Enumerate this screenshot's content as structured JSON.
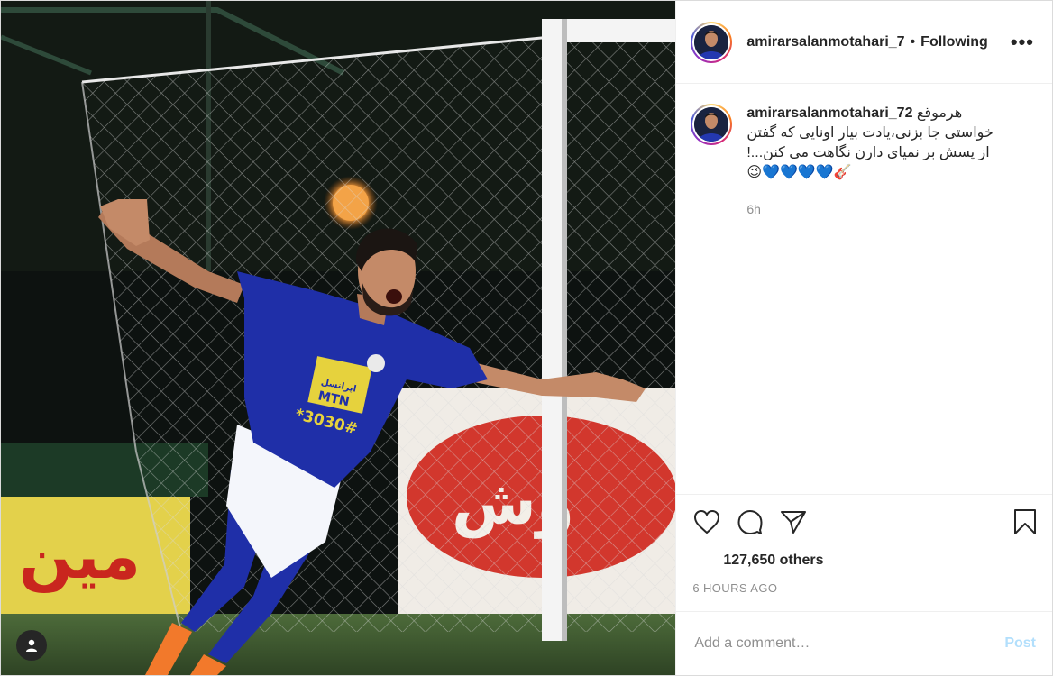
{
  "post": {
    "author": {
      "username": "amirarsalanmotahari_7",
      "follow_separator": "•",
      "follow_status": "Following"
    },
    "more_label": "•••",
    "caption": {
      "username": "amirarsalanmotahari_72",
      "line1": "هرموقع",
      "line2": "خواستی جا بزنی،یادت بیار اونایی که گفتن",
      "line3": "!...از پسش بر نمیای دارن نگاهت می کنن",
      "emojis": "😉💙💙💙💙🎸",
      "relative_time": "6h"
    },
    "likes": "127,650 others",
    "timestamp": "6 HOURS AGO",
    "comment_box": {
      "placeholder": "Add a comment…",
      "post_label": "Post"
    },
    "media": {
      "shirt_sponsor_top": "ایرانسل",
      "shirt_sponsor_bottom": "MTN",
      "shirt_number": "*3030#"
    }
  },
  "colors": {
    "text": "#262626",
    "muted": "#8e8e8e",
    "post_button_disabled": "#b2dffc",
    "kit_blue": "#1f2fa8"
  },
  "icons": {
    "like": "heart-icon",
    "comment": "comment-icon",
    "share": "share-icon",
    "save": "bookmark-icon",
    "tagged": "user-tag-icon",
    "more": "more-options-icon"
  }
}
